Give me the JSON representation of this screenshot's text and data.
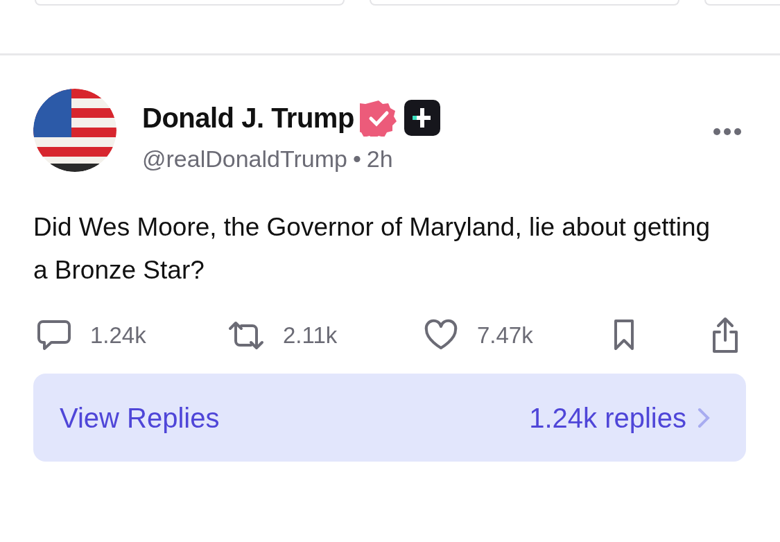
{
  "post": {
    "author": "Donald J. Trump",
    "verified": true,
    "handle": "@realDonaldTrump",
    "separator": "•",
    "time": "2h",
    "text": "Did Wes Moore, the Governor of Maryland, lie about getting a Bronze Star?",
    "stats": [
      {
        "kind": "reply",
        "count": "1.24k"
      },
      {
        "kind": "repost",
        "count": "2.11k"
      },
      {
        "kind": "like",
        "count": "7.47k",
        "selected": false
      }
    ],
    "bookmarked": false
  },
  "replies_bar": {
    "label": "View Replies",
    "count": "1.24k replies"
  }
}
